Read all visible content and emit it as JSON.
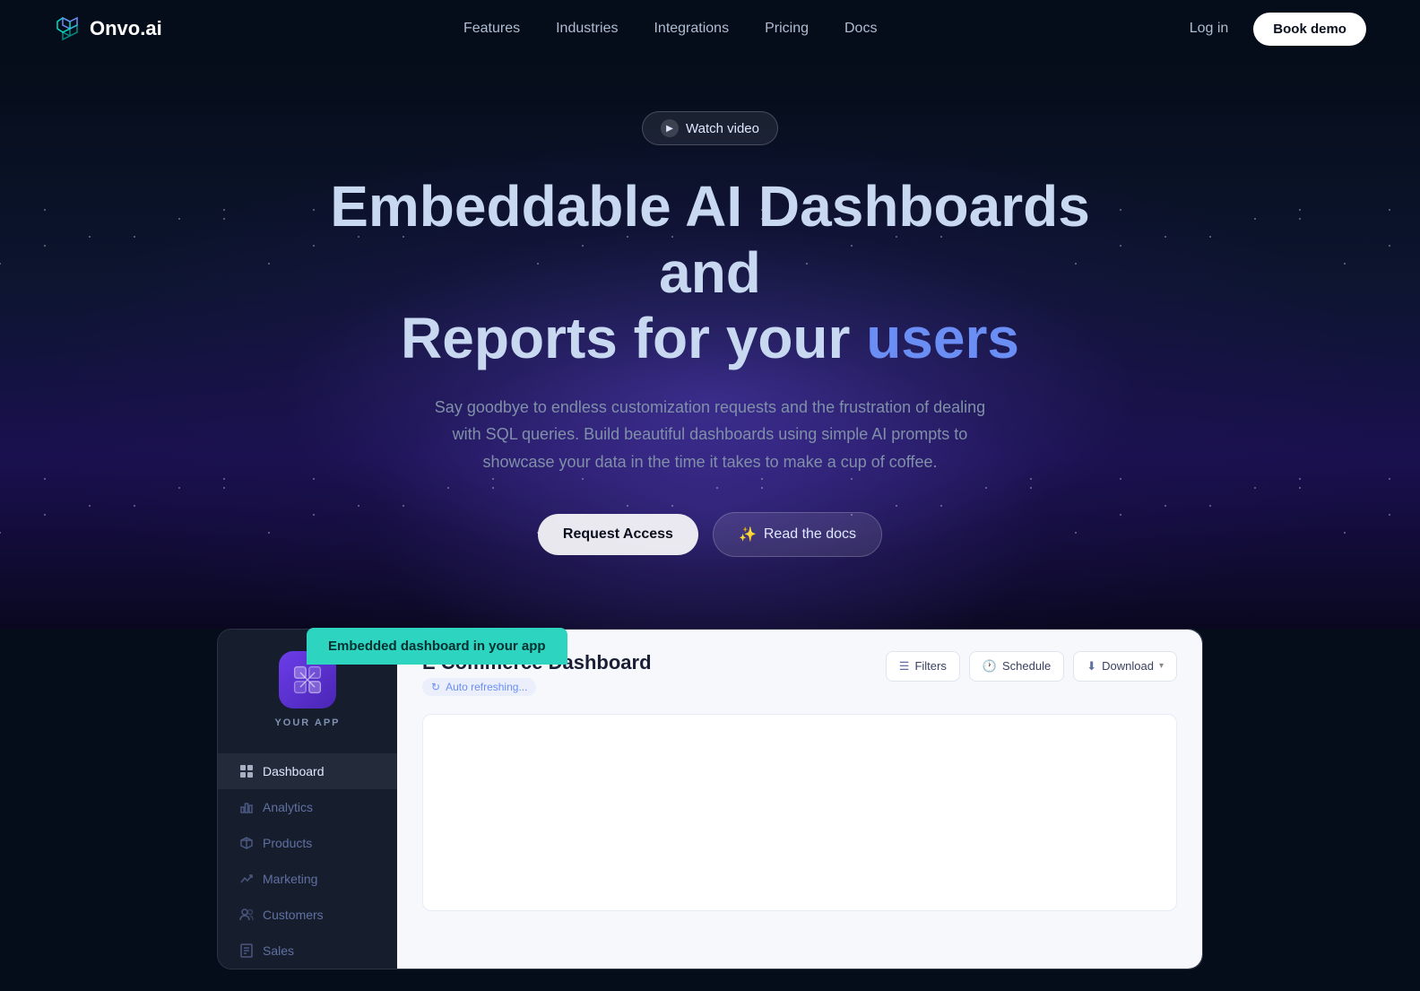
{
  "meta": {
    "title": "Onvo.ai - Embeddable AI Dashboards"
  },
  "navbar": {
    "logo_text": "Onvo.ai",
    "links": [
      {
        "label": "Features",
        "href": "#"
      },
      {
        "label": "Industries",
        "href": "#"
      },
      {
        "label": "Integrations",
        "href": "#"
      },
      {
        "label": "Pricing",
        "href": "#"
      },
      {
        "label": "Docs",
        "href": "#"
      }
    ],
    "login_label": "Log in",
    "book_demo_label": "Book demo"
  },
  "hero": {
    "watch_video_label": "Watch video",
    "title_part1": "Embeddable AI Dashboards and",
    "title_part2": "Reports for your ",
    "title_highlight": "users",
    "subtitle": "Say goodbye to endless customization requests and the frustration of dealing with SQL queries. Build beautiful dashboards using simple AI prompts to showcase your data in the time it takes to make a cup of coffee.",
    "request_access_label": "Request Access",
    "read_docs_label": "Read the docs"
  },
  "demo": {
    "embedded_badge": "Embedded dashboard in your app",
    "app_name": "YOUR APP",
    "sidebar_items": [
      {
        "label": "Dashboard",
        "icon": "grid-icon",
        "active": true
      },
      {
        "label": "Analytics",
        "icon": "bar-chart-icon",
        "active": false
      },
      {
        "label": "Products",
        "icon": "box-icon",
        "active": false
      },
      {
        "label": "Marketing",
        "icon": "trending-icon",
        "active": false
      },
      {
        "label": "Customers",
        "icon": "users-icon",
        "active": false
      },
      {
        "label": "Sales",
        "icon": "receipt-icon",
        "active": false
      }
    ],
    "dashboard_title": "E Commerce Dashboard",
    "auto_refresh_label": "Auto refreshing...",
    "filters_label": "Filters",
    "schedule_label": "Schedule",
    "download_label": "Download"
  }
}
